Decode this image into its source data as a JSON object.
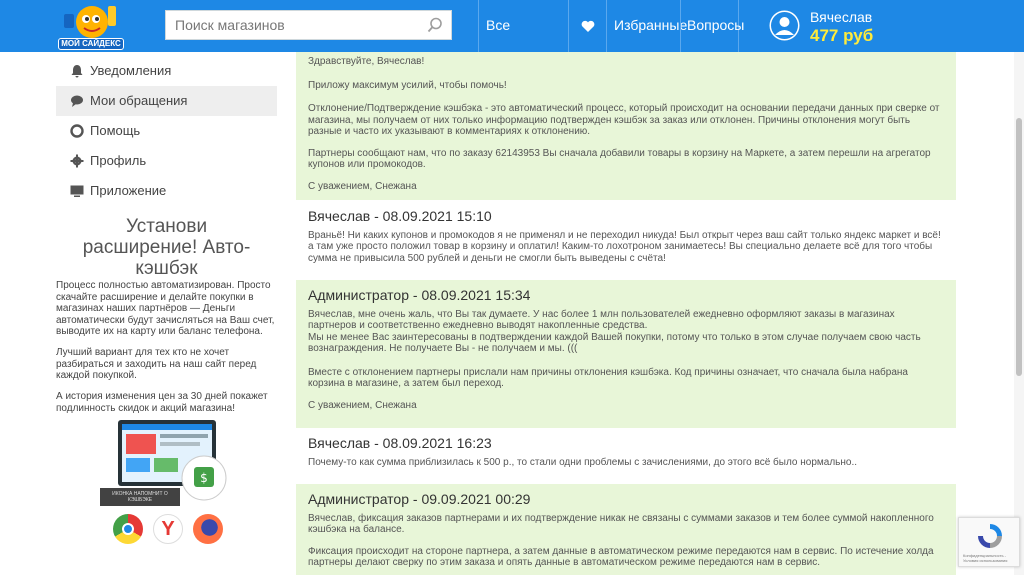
{
  "header": {
    "logo_text": "МОЙ САЙДЕКС",
    "search_placeholder": "Поиск магазинов",
    "nav": [
      "Все магазины",
      "Избранные",
      "Вопросы"
    ],
    "user_name": "Вячеслав",
    "user_balance": "477 руб"
  },
  "sidebar": {
    "menu": [
      {
        "label": "Уведомления",
        "icon": "bell-icon"
      },
      {
        "label": "Мои обращения",
        "icon": "chat-icon",
        "active": true
      },
      {
        "label": "Помощь",
        "icon": "lifebuoy-icon"
      },
      {
        "label": "Профиль",
        "icon": "gear-icon"
      },
      {
        "label": "Приложение",
        "icon": "monitor-icon"
      }
    ],
    "promo_title": "Установи расширение! Авто-кэшбэк",
    "promo_p1": "Процесс полностью автоматизирован. Просто скачайте расширение и делайте покупки в магазинах наших партнёров — Деньги автоматически будут зачисляться на Ваш счет, выводите их на карту или баланс телефона.",
    "promo_p2": "Лучший вариант для тех кто не хочет разбираться и заходить на наш сайт перед каждой покупкой.",
    "promo_p3": "А история изменения цен за 30 дней покажет подлинность скидок и акций магазина!",
    "laptop_caption": "ИКОНКА НАПОМНИТ О КЭШБЭКЕ"
  },
  "thread": {
    "m1": {
      "p1": "Здравствуйте, Вячеслав!",
      "p2": "Приложу максимум усилий, чтобы помочь!",
      "p3": "Отклонение/Подтверждение кэшбэка - это автоматический процесс, который происходит на основании передачи данных при сверке от магазина, мы получаем от них только информацию подтвержден кэшбэк за заказ или отклонен. Причины отклонения могут быть разные и часто их указывают в комментариях к отклонению.",
      "p4": "Партнеры сообщают нам, что по заказу 62143953 Вы сначала добавили товары в корзину на Маркете, а затем перешли на агрегатор купонов или промокодов.",
      "p5": "С уважением, Снежана"
    },
    "m2": {
      "author": "Вячеслав - 08.09.2021 15:10",
      "p1": "Враньё! Ни каких купонов и промокодов я не применял и не переходил никуда! Был открыт через ваш сайт только яндекс маркет и всё! а там уже просто положил товар в корзину и оплатил! Каким-то лохотроном занимаетесь! Вы специально делаете всё для того чтобы сумма не привысила 500 рублей и деньги не смогли быть выведены с счёта!"
    },
    "m3": {
      "author": "Администратор - 08.09.2021 15:34",
      "p1": "Вячеслав, мне очень жаль, что Вы так думаете. У нас более 1 млн пользователей ежедневно оформляют заказы в магазинах партнеров и соответственно ежедневно выводят накопленные средства.",
      "p1b": "Мы не менее Вас заинтересованы в подтверждении каждой Вашей покупки, потому что только в этом случае получаем свою часть вознаграждения. Не получаете Вы - не получаем и мы. (((",
      "p2": "Вместе с отклонением партнеры прислали нам причины отклонения кэшбэка. Код причины означает, что сначала была набрана корзина в магазине, а затем был переход.",
      "p3": "С уважением, Снежана"
    },
    "m4": {
      "author": "Вячеслав - 08.09.2021 16:23",
      "p1": "Почему-то как сумма приблизилась к 500 р., то стали одни проблемы с зачислениями, до этого всё было нормально.."
    },
    "m5": {
      "author": "Администратор - 09.09.2021 00:29",
      "p1": "Вячеслав, фиксация заказов партнерами и их подтверждение никак не связаны с суммами заказов и тем более суммой накопленного кэшбэка на балансе.",
      "p2": "Фиксация происходит на стороне партнера, а затем данные в автоматическом режиме передаются нам в сервис. По истечение холда партнеры делают сверку по этим заказа и опять данные в автоматическом режиме передаются нам в сервис."
    }
  },
  "recaptcha_text": "Конфиденциальность - Условия использования",
  "colors": {
    "header": "#1e88e5",
    "balance": "#ffeb3b",
    "admin_bg": "#e8f6d8"
  }
}
